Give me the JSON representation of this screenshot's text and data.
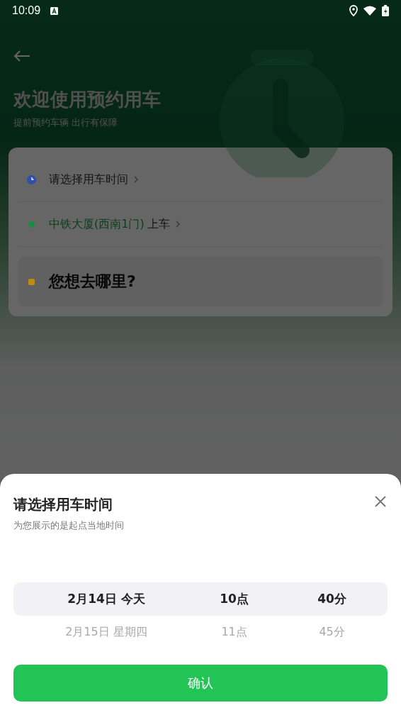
{
  "status_bar": {
    "time": "10:09"
  },
  "header": {
    "title": "欢迎使用预约用车",
    "subtitle": "提前预约车辆 出行有保障"
  },
  "trip_card": {
    "rows": [
      {
        "kind": "time",
        "color": "#2f4fa8",
        "label": "请选择用车时间"
      },
      {
        "kind": "pickup",
        "color": "#1e8a3e",
        "place": "中铁大厦(西南1门)",
        "suffix": "上车"
      },
      {
        "kind": "destination",
        "color": "#c08a10",
        "label": "您想去哪里?"
      }
    ]
  },
  "time_sheet": {
    "title": "请选择用车时间",
    "subtitle": "为您展示的是起点当地时间",
    "picker_rows": [
      {
        "selected": true,
        "date": "2月14日 今天",
        "hour": "10点",
        "minute": "40分"
      },
      {
        "selected": false,
        "date": "2月15日 星期四",
        "hour": "11点",
        "minute": "45分"
      }
    ],
    "confirm_button": "确认"
  }
}
